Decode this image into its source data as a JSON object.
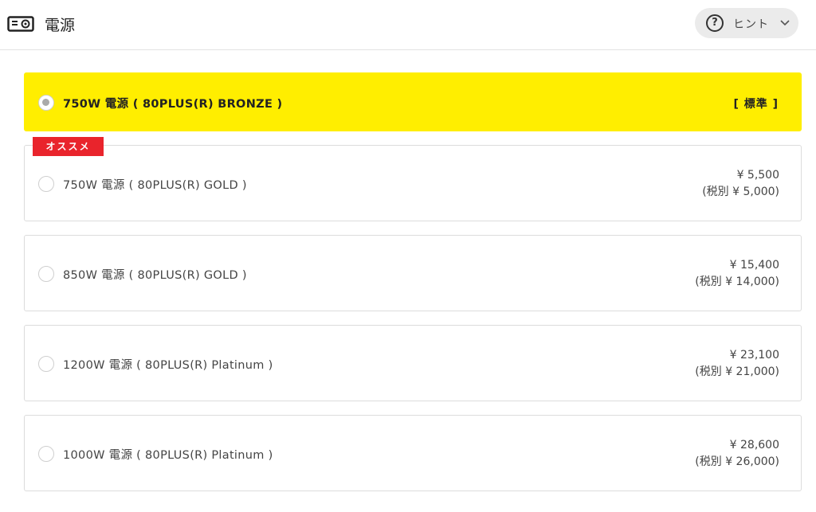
{
  "header": {
    "title": "電源",
    "hint_label": "ヒント"
  },
  "options": [
    {
      "label": "750W 電源 ( 80PLUS(R) BRONZE )",
      "standard": "[ 標準 ]",
      "selected": true
    },
    {
      "label": "750W 電源 ( 80PLUS(R) GOLD )",
      "badge": "オススメ",
      "price": "¥ 5,500",
      "price_excl": "(税別 ¥ 5,000)",
      "selected": false
    },
    {
      "label": "850W 電源 ( 80PLUS(R) GOLD )",
      "price": "¥ 15,400",
      "price_excl": "(税別 ¥ 14,000)",
      "selected": false
    },
    {
      "label": "1200W 電源 ( 80PLUS(R) Platinum )",
      "price": "¥ 23,100",
      "price_excl": "(税別 ¥ 21,000)",
      "selected": false
    },
    {
      "label": "1000W 電源 ( 80PLUS(R) Platinum )",
      "price": "¥ 28,600",
      "price_excl": "(税別 ¥ 26,000)",
      "selected": false
    }
  ],
  "colors": {
    "selected_bg": "#ffee00",
    "badge_bg": "#e9242c"
  },
  "icons": {
    "header": "power-supply-icon",
    "hint": "question-circle-icon",
    "chevron": "chevron-down-icon"
  }
}
